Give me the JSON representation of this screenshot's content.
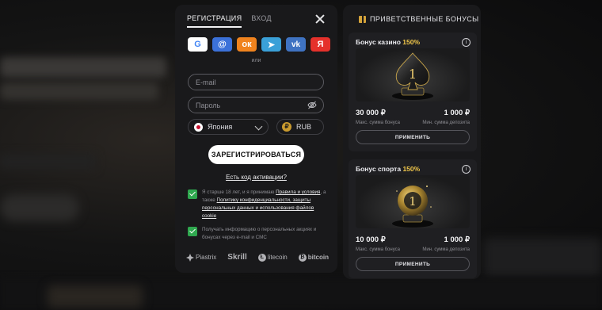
{
  "registration": {
    "tabs": [
      {
        "label": "РЕГИСТРАЦИЯ",
        "active": true
      },
      {
        "label": "ВХОД",
        "active": false
      }
    ],
    "social_buttons": [
      {
        "name": "google",
        "glyph": "G",
        "color": "#ffffff"
      },
      {
        "name": "mailru",
        "glyph": "@",
        "color": "#3b71d9"
      },
      {
        "name": "odnoklassniki",
        "glyph": "ок",
        "color": "#f0831e"
      },
      {
        "name": "telegram",
        "glyph": "➤",
        "color": "#3aa0d8"
      },
      {
        "name": "vkontakte",
        "glyph": "vk",
        "color": "#3f73c2"
      },
      {
        "name": "yandex",
        "glyph": "Я",
        "color": "#e5312b"
      }
    ],
    "or_label": "или",
    "email_placeholder": "E-mail",
    "password_placeholder": "Пароль",
    "country": "Япония",
    "currency": "RUB",
    "currency_symbol": "₽",
    "submit_label": "ЗАРЕГИСТРИРОВАТЬСЯ",
    "activation_code_link": "Есть код активации?",
    "consent1": {
      "checked": true,
      "text_a": "Я старше 18 лет, и я принимаю ",
      "link_rules": "Правила и условия",
      "text_b": ", а также ",
      "link_privacy": "Политику конфиденциальности, защиты персональных данных и использования файлов cookie"
    },
    "consent2": {
      "checked": true,
      "text": "Получать информацию о персональных акциях и бонусах через e-mail и СМС"
    },
    "payment_logos": [
      "Piastrix",
      "Skrill",
      "litecoin",
      "bitcoin"
    ]
  },
  "bonuses": {
    "title": "ПРИВЕТСТВЕННЫЕ БОНУСЫ",
    "cards": [
      {
        "title": "Бонус казино ",
        "percent": "150%",
        "max_amount": "30 000 ₽",
        "max_caption": "Макс. сумма бонуса",
        "min_deposit": "1 000 ₽",
        "min_caption": "Мин. сумма депозита",
        "apply_label": "ПРИМЕНИТЬ",
        "art_icon": "spade-one-trophy-icon"
      },
      {
        "title": "Бонус спорта ",
        "percent": "150%",
        "max_amount": "10 000 ₽",
        "max_caption": "Макс. сумма бонуса",
        "min_deposit": "1 000 ₽",
        "min_caption": "Мин. сумма депозита",
        "apply_label": "ПРИМЕНИТЬ",
        "art_icon": "ball-one-trophy-icon"
      }
    ]
  },
  "colors": {
    "accent_gold": "#f3c94b",
    "checkbox_green": "#2fa84f",
    "panel": "#19191b"
  }
}
